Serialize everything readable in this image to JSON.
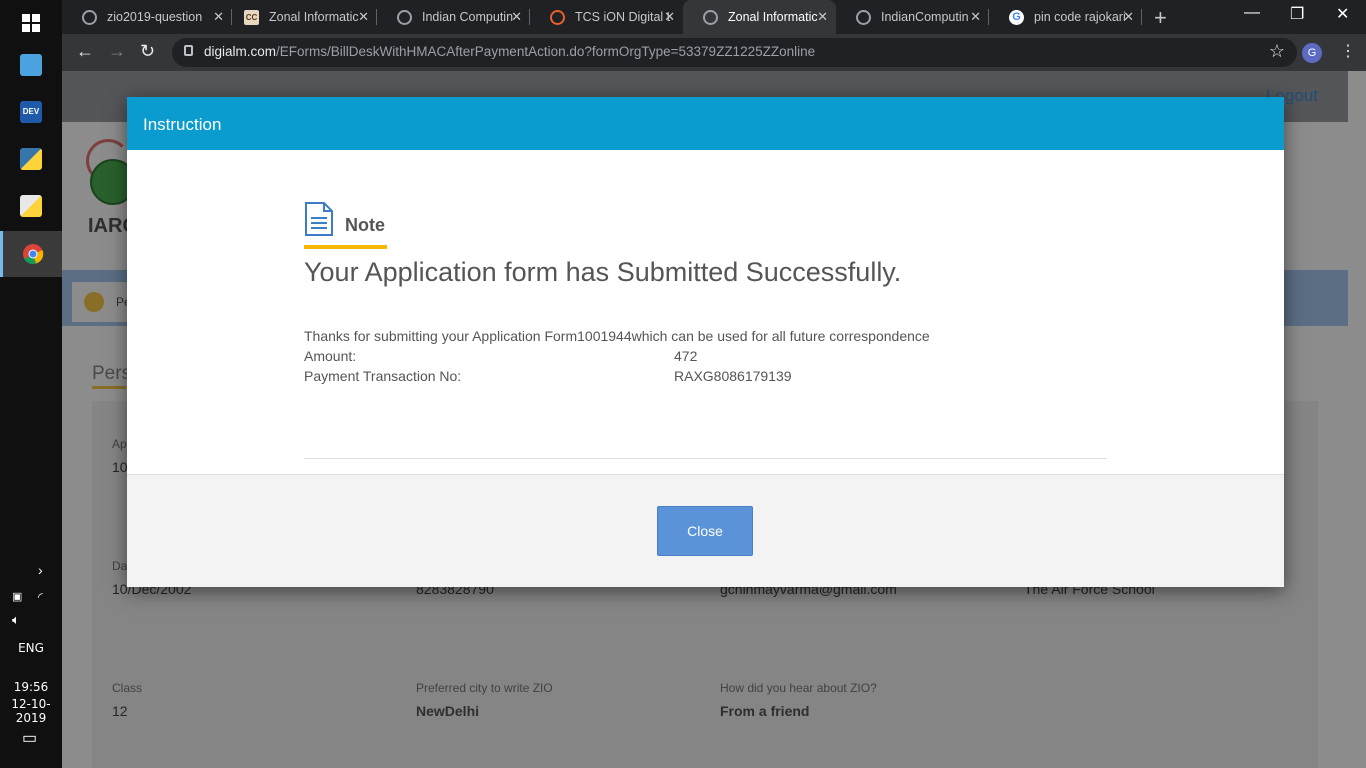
{
  "taskbar": {
    "lang": "ENG",
    "time": "19:56",
    "date": "12-10-2019"
  },
  "browser": {
    "tabs": [
      {
        "title": "zio2019-question",
        "icon": "globe-icon"
      },
      {
        "title": "Zonal Informatic",
        "icon": "cc-icon"
      },
      {
        "title": "Indian Computin",
        "icon": "globe-icon"
      },
      {
        "title": "TCS iON Digital L",
        "icon": "tcs-icon"
      },
      {
        "title": "Zonal Informatic",
        "icon": "globe-icon",
        "active": true
      },
      {
        "title": "IndianComputin",
        "icon": "globe-icon"
      },
      {
        "title": "pin code rajokari",
        "icon": "google-icon"
      }
    ],
    "url_host": "digialm.com",
    "url_path": "/EForms/BillDeskWithHMACAfterPaymentAction.do?formOrgType=53379ZZ1225ZZonline",
    "profile_initial": "G"
  },
  "page": {
    "logout": "Logout",
    "logo_text": "IARC",
    "bluebar_text": "Pe",
    "section_title": "Pers",
    "fields": {
      "row1_label": "Ap",
      "row1_value": "10",
      "dob_label": "Da",
      "dob_value": "10/Dec/2002",
      "phone_value": "8283828790",
      "email_value": "gchinmayvarma@gmail.com",
      "school_value": "The Air Force School",
      "class_label": "Class",
      "class_value": "12",
      "city_label": "Preferred city to write ZIO",
      "city_value": "NewDelhi",
      "hear_label": "How did you hear about ZIO?",
      "hear_value": "From a friend"
    }
  },
  "modal": {
    "header": "Instruction",
    "note_label": "Note",
    "success_title": "Your Application form has Submitted Successfully.",
    "thanks_text": "Thanks for submitting your Application Form1001944which can be used for all future correspondence",
    "amount_label": "Amount:",
    "amount_value": "472",
    "txn_label": "Payment Transaction No:",
    "txn_value": "RAXG8086179139",
    "close_label": "Close"
  },
  "colors": {
    "modal_header": "#0b9ccf",
    "note_underline": "#f5b800",
    "close_button": "#5b93d8"
  }
}
